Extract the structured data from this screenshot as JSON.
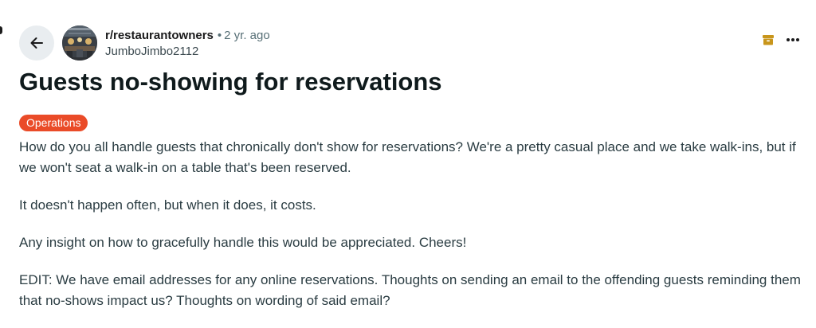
{
  "post": {
    "subreddit": "r/restaurantowners",
    "separator": "•",
    "age": "2 yr. ago",
    "author": "JumboJimbo2112",
    "title": "Guests no-showing for reservations",
    "flair": "Operations",
    "paragraphs": [
      "How do you all handle guests that chronically don't show for reservations? We're a pretty casual place and we take walk-ins, but if we won't seat a walk-in on a table that's been reserved.",
      "It doesn't happen often, but when it does, it costs.",
      "Any insight on how to gracefully handle this would be appreciated. Cheers!",
      "EDIT: We have email addresses for any online reservations. Thoughts on sending an email to the offending guests reminding them that no-shows impact us? Thoughts on wording of said email?"
    ]
  },
  "icons": {
    "back": "arrow-left-icon",
    "archive": "archive-icon",
    "more": "more-options-icon"
  },
  "colors": {
    "flair_bg": "#ea4b28",
    "archive_icon": "#c8951b",
    "back_button_bg": "#e9edf0"
  }
}
